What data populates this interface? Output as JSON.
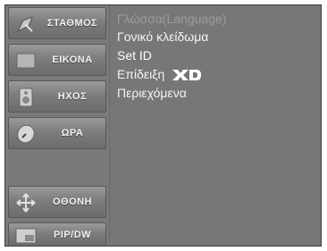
{
  "sidebar": {
    "items": [
      {
        "label": "ΣΤΑΘΜΟΣ",
        "icon": "satellite-dish-icon"
      },
      {
        "label": "ΕΙΚΟΝΑ",
        "icon": "picture-icon"
      },
      {
        "label": "ΗΧΟΣ",
        "icon": "speaker-icon"
      },
      {
        "label": "ΩΡΑ",
        "icon": "clock-icon"
      },
      {
        "label": "ΟΘΟΝΗ",
        "icon": "screen-arrows-icon"
      },
      {
        "label": "PIP/DW",
        "icon": "pip-icon"
      }
    ]
  },
  "menu": {
    "items": [
      {
        "label": "Γλώσσα(Language)"
      },
      {
        "label": "Γονικό κλείδωμα"
      },
      {
        "label": "Set ID"
      },
      {
        "label": "Επίδειξη",
        "badge": "XD"
      },
      {
        "label": "Περιεχόμενα"
      }
    ]
  }
}
